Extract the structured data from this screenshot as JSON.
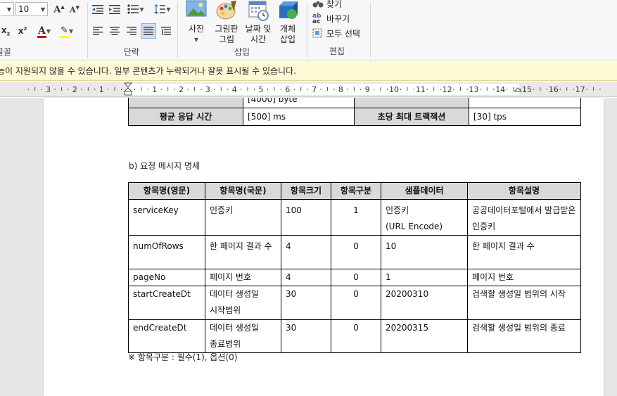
{
  "ribbon": {
    "font_size": "10",
    "groups": {
      "font": "글꼴",
      "paragraph": "단락",
      "insert": "삽입",
      "editing": "편집"
    },
    "insert_buttons": [
      {
        "label_line1": "사진",
        "label_line2": ""
      },
      {
        "label_line1": "그림판",
        "label_line2": "그림"
      },
      {
        "label_line1": "날짜 및",
        "label_line2": "시간"
      },
      {
        "label_line1": "개체",
        "label_line2": "삽입"
      }
    ],
    "editing": {
      "find": "찾기",
      "replace": "바꾸기",
      "select_all": "모두 선택"
    },
    "colors": {
      "font_color": "#c00000",
      "highlight": "#ffff00"
    }
  },
  "infobar": {
    "message": "능이 지원되지 않을 수 있습니다. 일부 콘텐츠가 누락되거나 잘못 표시될 수 있습니다."
  },
  "ruler": {
    "labels": [
      "3",
      "2",
      "1",
      "1",
      "2",
      "3",
      "4",
      "5",
      "6",
      "7",
      "8",
      "9",
      "10",
      "11",
      "12",
      "13",
      "14",
      "15",
      "16",
      "17"
    ]
  },
  "document": {
    "top_table": {
      "hidden_row_value": "[4000] byte",
      "row": {
        "label1": "평균 응답 시간",
        "value1": "[500] ms",
        "label2": "초당 최대 트랙잭션",
        "value2": "[30] tps"
      }
    },
    "section_title": "b) 요청 메시지 명세",
    "request_table": {
      "headers": [
        "항목명(영문)",
        "항목명(국문)",
        "항목크기",
        "항목구분",
        "샘플데이터",
        "항목설명"
      ],
      "rows": [
        {
          "en": "serviceKey",
          "kr": "인증키",
          "size": "100",
          "type": "1",
          "sample": "인증키",
          "sample2": "(URL Encode)",
          "desc": "공공데이터포털에서 발급받은 인증키"
        },
        {
          "en": "numOfRows",
          "kr": "한 페이지 결과 수",
          "size": "4",
          "type": "0",
          "sample": "10",
          "sample2": "",
          "desc": "한 페이지 결과 수"
        },
        {
          "en": "pageNo",
          "kr": "페이지 번호",
          "size": "4",
          "type": "0",
          "sample": "1",
          "sample2": "",
          "desc": "페이지 번호"
        },
        {
          "en": "startCreateDt",
          "kr": "데이터 생성일 시작범위",
          "size": "30",
          "type": "0",
          "sample": "20200310",
          "sample2": "",
          "desc": "검색할 생성일 범위의 시작"
        },
        {
          "en": "endCreateDt",
          "kr": "데이터 생성일 종료범위",
          "size": "30",
          "type": "0",
          "sample": "20200315",
          "sample2": "",
          "desc": "검색할 생성일 범위의 종료"
        }
      ]
    },
    "footnote": "※ 항목구분 : 필수(1), 옵션(0)"
  }
}
